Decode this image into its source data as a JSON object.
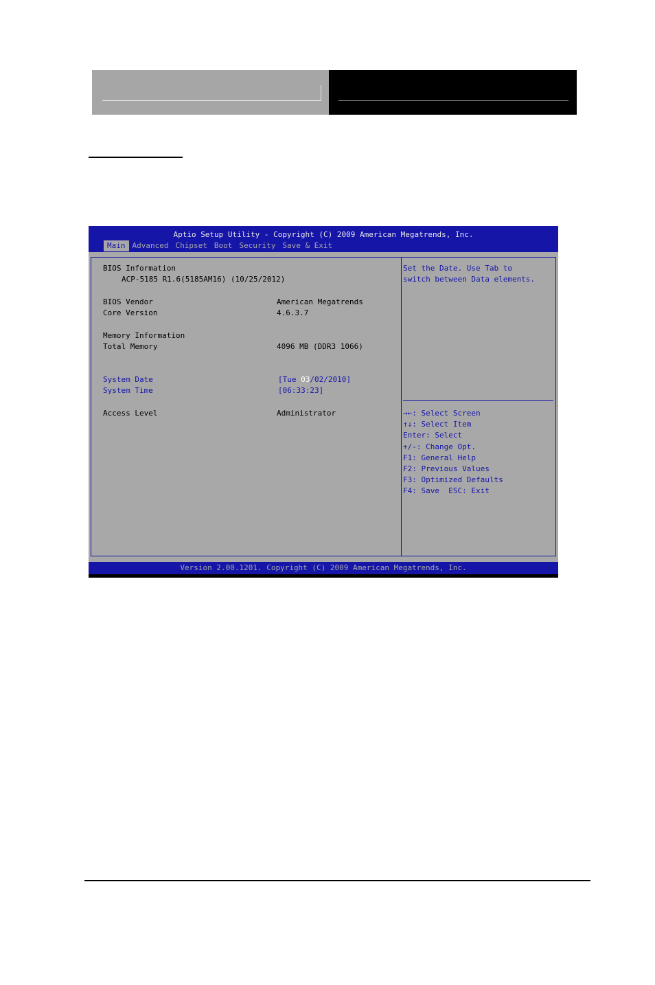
{
  "bios": {
    "title": "Aptio Setup Utility - Copyright (C) 2009 American Megatrends, Inc.",
    "menu": [
      "Main",
      "Advanced",
      "Chipset",
      "Boot",
      "Security",
      "Save & Exit"
    ],
    "main": {
      "bios_info_heading": "BIOS Information",
      "bios_info_value": "ACP-5185 R1.6(5185AM16) (10/25/2012)",
      "vendor_label": "BIOS Vendor",
      "vendor_value": "American Megatrends",
      "core_label": "Core Version",
      "core_value": "4.6.3.7",
      "memory_heading": "Memory Information",
      "total_memory_label": "Total Memory",
      "total_memory_value": "4096 MB (DDR3 1066)",
      "system_date_label": "System Date",
      "system_date_prefix": "[Tue ",
      "system_date_highlight": "03",
      "system_date_suffix": "/02/2010]",
      "system_time_label": "System Time",
      "system_time_value": "[06:33:23]",
      "access_level_label": "Access Level",
      "access_level_value": "Administrator"
    },
    "help": {
      "line1": "Set the Date. Use Tab to",
      "line2": "switch between Data elements."
    },
    "keys": [
      "→←: Select Screen",
      "↑↓: Select Item",
      "Enter: Select",
      "+/-: Change Opt.",
      "F1: General Help",
      "F2: Previous Values",
      "F3: Optimized Defaults",
      "F4: Save  ESC: Exit"
    ],
    "status": "Version 2.00.1201. Copyright (C) 2009 American Megatrends, Inc."
  }
}
